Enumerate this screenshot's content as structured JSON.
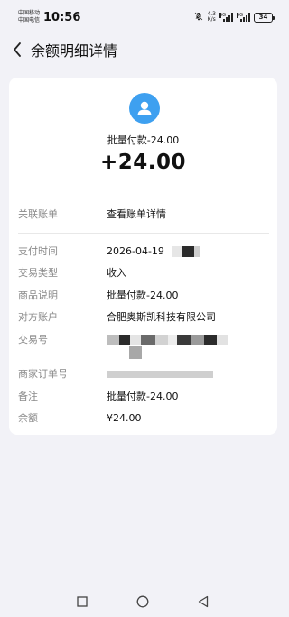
{
  "status_bar": {
    "carrier_1": "中国移动",
    "carrier_2": "中国电信",
    "time": "10:56",
    "net_speed_value": "4.3",
    "net_speed_unit": "K/s",
    "sim1_label": "5G",
    "sim2_label": "5G",
    "battery": "34"
  },
  "header": {
    "title": "余额明细详情"
  },
  "summary": {
    "subject": "批量付款-24.00",
    "amount": "+24.00"
  },
  "linked_account": {
    "label": "关联账单",
    "link_text": "查看账单详情"
  },
  "details": {
    "pay_time": {
      "label": "支付时间",
      "value": "2026-04-19"
    },
    "trade_type": {
      "label": "交易类型",
      "value": "收入"
    },
    "goods_desc": {
      "label": "商品说明",
      "value": "批量付款-24.00"
    },
    "counterparty": {
      "label": "对方账户",
      "value": "合肥奥斯凯科技有限公司"
    },
    "trade_no": {
      "label": "交易号",
      "value": ""
    },
    "merchant_order": {
      "label": "商家订单号",
      "value": ""
    },
    "remark": {
      "label": "备注",
      "value": "批量付款-24.00"
    },
    "balance": {
      "label": "余额",
      "value": "¥24.00"
    }
  },
  "colors": {
    "accent_link": "#1a56b8",
    "avatar_bg": "#3ea0f0",
    "page_bg": "#f2f2f7"
  }
}
